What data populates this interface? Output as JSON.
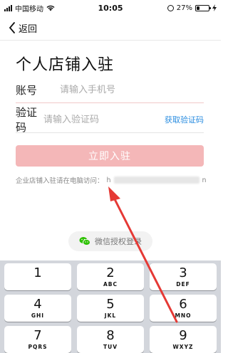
{
  "status_bar": {
    "carrier": "中国移动",
    "time": "10:05",
    "battery": "27%",
    "battery_level": 0.27
  },
  "nav": {
    "back_label": "返回"
  },
  "title": "个人店铺入驻",
  "form": {
    "account_label": "账号",
    "account_placeholder": "请输入手机号",
    "code_label": "验证码",
    "code_placeholder": "请输入验证码",
    "get_code": "获取验证码",
    "submit": "立即入驻"
  },
  "hint": {
    "text": "企业店铺入驻请在电脑访问：",
    "url_start": "h",
    "url_end": "n"
  },
  "wechat": {
    "label": "微信授权登录"
  },
  "keypad": {
    "keys": [
      {
        "num": "1",
        "letters": ""
      },
      {
        "num": "2",
        "letters": "ABC"
      },
      {
        "num": "3",
        "letters": "DEF"
      },
      {
        "num": "4",
        "letters": "GHI"
      },
      {
        "num": "5",
        "letters": "JKL"
      },
      {
        "num": "6",
        "letters": "MNO"
      },
      {
        "num": "7",
        "letters": "PQRS"
      },
      {
        "num": "8",
        "letters": "TUV"
      },
      {
        "num": "9",
        "letters": "WXYZ"
      }
    ]
  },
  "colors": {
    "accent_red": "#e53935",
    "submit_disabled": "#f4b7b8",
    "link_blue": "#2a8de0",
    "wechat_green": "#2dc100"
  }
}
